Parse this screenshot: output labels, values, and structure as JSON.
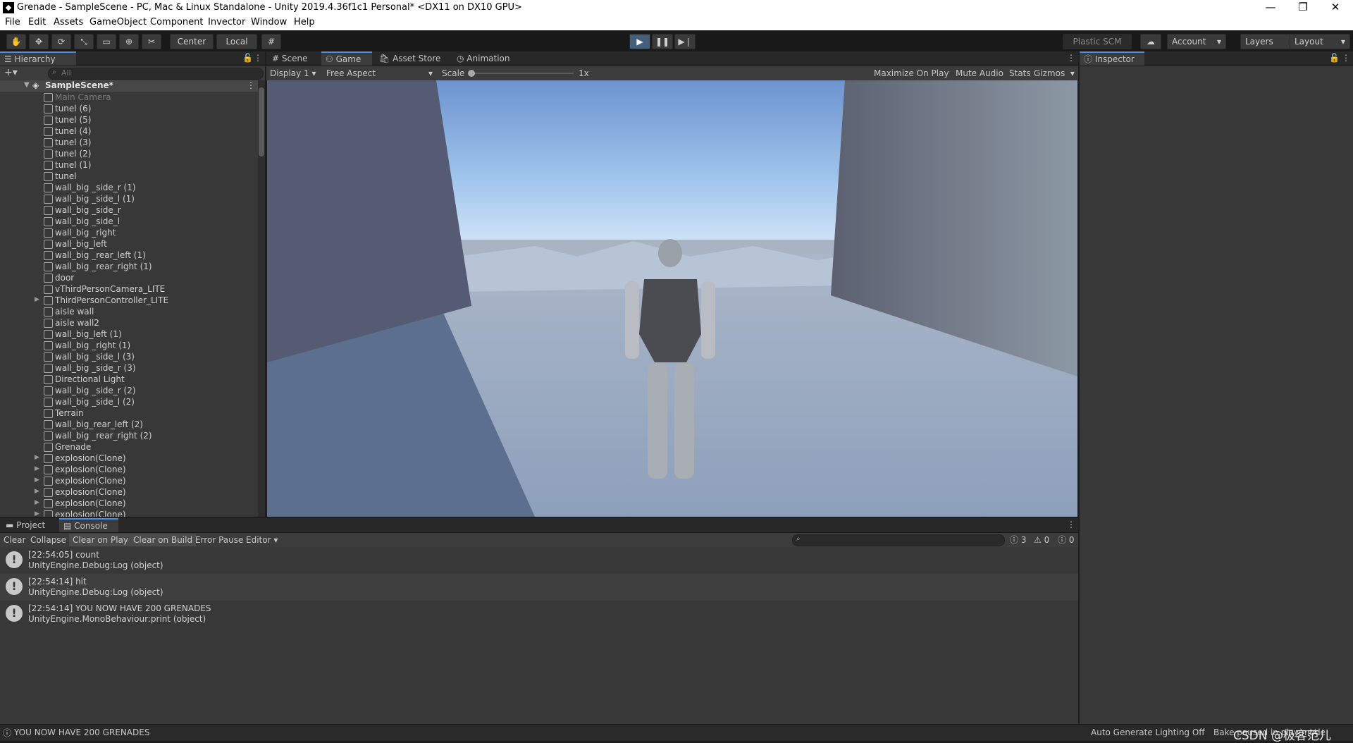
{
  "window": {
    "title": "Grenade - SampleScene - PC, Mac & Linux Standalone - Unity 2019.4.36f1c1 Personal* <DX11 on DX10 GPU>",
    "controls": [
      "—",
      "❐",
      "✕"
    ]
  },
  "menu": [
    "File",
    "Edit",
    "Assets",
    "GameObject",
    "Component",
    "Invector",
    "Window",
    "Help"
  ],
  "toolbar": {
    "pivot": "Center",
    "space": "Local",
    "plastic": "Plastic SCM",
    "account": "Account",
    "layers": "Layers",
    "layout": "Layout"
  },
  "hierarchy": {
    "tab": "Hierarchy",
    "search_placeholder": "All",
    "scene": "SampleScene*",
    "items": [
      {
        "label": "Main Camera",
        "dim": true
      },
      {
        "label": "tunel (6)"
      },
      {
        "label": "tunel (5)"
      },
      {
        "label": "tunel (4)"
      },
      {
        "label": "tunel (3)"
      },
      {
        "label": "tunel (2)"
      },
      {
        "label": "tunel (1)"
      },
      {
        "label": "tunel"
      },
      {
        "label": "wall_big _side_r (1)"
      },
      {
        "label": "wall_big _side_l (1)"
      },
      {
        "label": "wall_big _side_r"
      },
      {
        "label": "wall_big _side_l"
      },
      {
        "label": "wall_big _right"
      },
      {
        "label": "wall_big_left"
      },
      {
        "label": "wall_big _rear_left (1)"
      },
      {
        "label": "wall_big _rear_right (1)"
      },
      {
        "label": "door"
      },
      {
        "label": "vThirdPersonCamera_LITE"
      },
      {
        "label": "ThirdPersonController_LITE",
        "expand": true
      },
      {
        "label": "aisle wall"
      },
      {
        "label": "aisle wall2"
      },
      {
        "label": "wall_big_left (1)"
      },
      {
        "label": "wall_big _right (1)"
      },
      {
        "label": "wall_big _side_l (3)"
      },
      {
        "label": "wall_big _side_r (3)"
      },
      {
        "label": "Directional Light"
      },
      {
        "label": "wall_big _side_r (2)"
      },
      {
        "label": "wall_big _side_l (2)"
      },
      {
        "label": "Terrain"
      },
      {
        "label": "wall_big_rear_left (2)"
      },
      {
        "label": "wall_big _rear_right (2)"
      },
      {
        "label": "Grenade"
      },
      {
        "label": "explosion(Clone)",
        "expand": true
      },
      {
        "label": "explosion(Clone)",
        "expand": true
      },
      {
        "label": "explosion(Clone)",
        "expand": true
      },
      {
        "label": "explosion(Clone)",
        "expand": true
      },
      {
        "label": "explosion(Clone)",
        "expand": true
      },
      {
        "label": "explosion(Clone)",
        "expand": true
      }
    ]
  },
  "center_tabs": [
    "Scene",
    "Game",
    "Asset Store",
    "Animation"
  ],
  "game_bar": {
    "display": "Display 1",
    "aspect": "Free Aspect",
    "scale_label": "Scale",
    "scale_value": "1x",
    "maximize": "Maximize On Play",
    "mute": "Mute Audio",
    "stats": "Stats",
    "gizmos": "Gizmos"
  },
  "inspector": {
    "tab": "Inspector"
  },
  "bottom_tabs": [
    "Project",
    "Console"
  ],
  "console": {
    "buttons": [
      "Clear",
      "Collapse",
      "Clear on Play",
      "Clear on Build",
      "Error Pause",
      "Editor"
    ],
    "counts": {
      "log": "3",
      "warn": "0",
      "error": "0"
    },
    "entries": [
      {
        "line1": "[22:54:05] count",
        "line2": "UnityEngine.Debug:Log (object)"
      },
      {
        "line1": "[22:54:14] hit",
        "line2": "UnityEngine.Debug:Log (object)"
      },
      {
        "line1": "[22:54:14] YOU NOW HAVE 200 GRENADES",
        "line2": "UnityEngine.MonoBehaviour:print (object)"
      }
    ]
  },
  "status": {
    "message": "YOU NOW HAVE 200 GRENADES",
    "lighting": "Auto Generate Lighting Off",
    "bake": "Bake paused in play mode",
    "watermark": "CSDN @极客范儿"
  }
}
